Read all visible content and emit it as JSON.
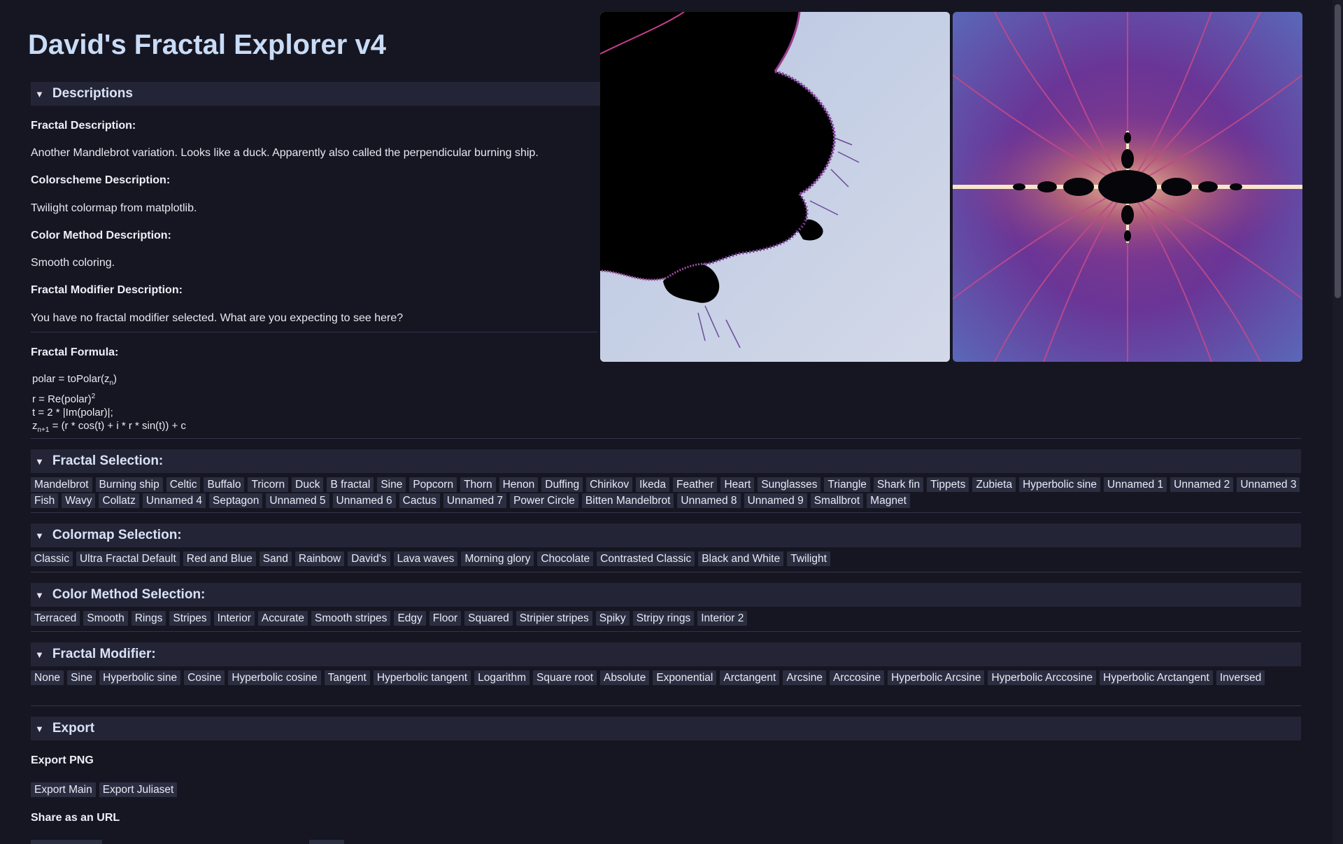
{
  "app": {
    "title": "David's Fractal Explorer v4"
  },
  "descriptions": {
    "header": "Descriptions",
    "fractal_label": "Fractal Description:",
    "fractal_text": "Another Mandlebrot variation. Looks like a duck. Apparently also called the perpendicular burning ship.",
    "colorscheme_label": "Colorscheme Description:",
    "colorscheme_text": "Twilight colormap from matplotlib.",
    "colormethod_label": "Color Method Description:",
    "colormethod_text": "Smooth coloring.",
    "modifier_label": "Fractal Modifier Description:",
    "modifier_text": "You have no fractal modifier selected. What are you expecting to see here?",
    "formula_label": "Fractal Formula:"
  },
  "formula": {
    "l1_a": "polar = toPolar(z",
    "l1_sub": "n",
    "l1_b": ")",
    "l2_a": "r = Re(polar)",
    "l2_sup": "2",
    "l3": "t = 2 * |Im(polar)|;",
    "l4_a": "z",
    "l4_sub": "n+1",
    "l4_b": " = (r * cos(t) + i * r * sin(t)) + c"
  },
  "fractal_selection": {
    "header": "Fractal Selection:",
    "items": [
      "Mandelbrot",
      "Burning ship",
      "Celtic",
      "Buffalo",
      "Tricorn",
      "Duck",
      "B fractal",
      "Sine",
      "Popcorn",
      "Thorn",
      "Henon",
      "Duffing",
      "Chirikov",
      "Ikeda",
      "Feather",
      "Heart",
      "Sunglasses",
      "Triangle",
      "Shark fin",
      "Tippets",
      "Zubieta",
      "Hyperbolic sine",
      "Unnamed 1",
      "Unnamed 2",
      "Unnamed 3",
      "Fish",
      "Wavy",
      "Collatz",
      "Unnamed 4",
      "Septagon",
      "Unnamed 5",
      "Unnamed 6",
      "Cactus",
      "Unnamed 7",
      "Power Circle",
      "Bitten Mandelbrot",
      "Unnamed 8",
      "Unnamed 9",
      "Smallbrot",
      "Magnet"
    ]
  },
  "colormap_selection": {
    "header": "Colormap Selection:",
    "items": [
      "Classic",
      "Ultra Fractal Default",
      "Red and Blue",
      "Sand",
      "Rainbow",
      "David's",
      "Lava waves",
      "Morning glory",
      "Chocolate",
      "Contrasted Classic",
      "Black and White",
      "Twilight"
    ]
  },
  "color_method_selection": {
    "header": "Color Method Selection:",
    "items": [
      "Terraced",
      "Smooth",
      "Rings",
      "Stripes",
      "Interior",
      "Accurate",
      "Smooth stripes",
      "Edgy",
      "Floor",
      "Squared",
      "Stripier stripes",
      "Spiky",
      "Stripy rings",
      "Interior 2"
    ]
  },
  "fractal_modifier": {
    "header": "Fractal Modifier:",
    "items": [
      "None",
      "Sine",
      "Hyperbolic sine",
      "Cosine",
      "Hyperbolic cosine",
      "Tangent",
      "Hyperbolic tangent",
      "Logarithm",
      "Square root",
      "Absolute",
      "Exponential",
      "Arctangent",
      "Arcsine",
      "Arccosine",
      "Hyperbolic Arcsine",
      "Hyperbolic Arccosine",
      "Hyperbolic Arctangent",
      "Inversed"
    ]
  },
  "export": {
    "header": "Export",
    "png_label": "Export PNG",
    "export_main": "Export Main",
    "export_julia": "Export Juliaset",
    "share_label": "Share as an URL"
  },
  "colors": {
    "background": "#161622",
    "header_bg": "#242437",
    "button_bg": "#2b2d40",
    "title": "#c9dcf7"
  }
}
